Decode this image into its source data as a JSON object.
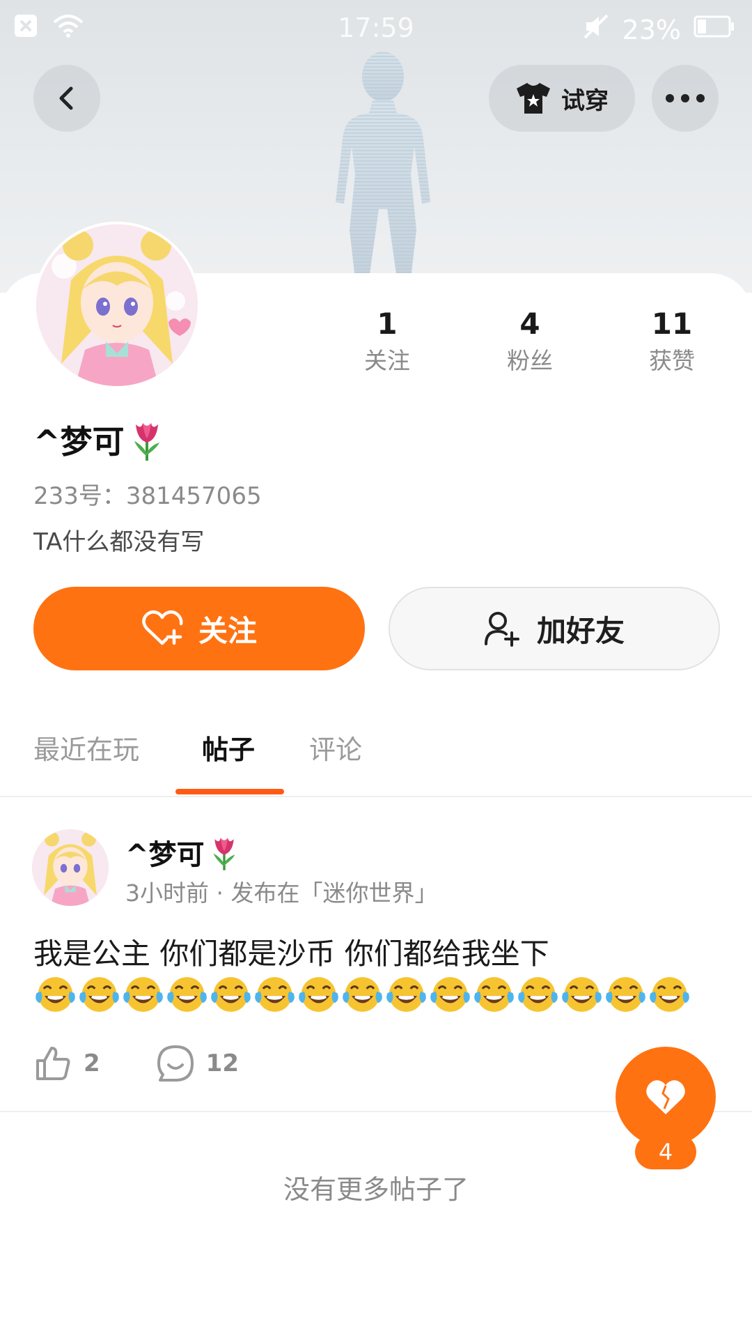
{
  "status_bar": {
    "time": "17:59",
    "battery_pct": "23%",
    "icons": [
      "close-notification-icon",
      "wifi-icon",
      "mute-icon",
      "battery-icon"
    ]
  },
  "header": {
    "try_on_label": "试穿",
    "icons": [
      "back-icon",
      "tshirt-icon",
      "more-icon"
    ]
  },
  "profile": {
    "nickname": "^梦可",
    "uid": "233号：381457065",
    "bio": "TA什么都没有写",
    "stats": [
      {
        "value": "1",
        "label": "关注"
      },
      {
        "value": "4",
        "label": "粉丝"
      },
      {
        "value": "11",
        "label": "获赞"
      }
    ],
    "follow_label": "关注",
    "add_friend_label": "加好友"
  },
  "tabs": [
    {
      "label": "最近在玩",
      "active": false
    },
    {
      "label": "帖子",
      "active": true
    },
    {
      "label": "评论",
      "active": false
    }
  ],
  "post": {
    "author": "^梦可",
    "meta": "3小时前 · 发布在「迷你世界」",
    "text": "我是公主 你们都是沙币 你们都给我坐下",
    "laugh_emoji_count": 15,
    "likes": "2",
    "comments": "12"
  },
  "end_text": "没有更多帖子了",
  "fab": {
    "badge": "4"
  },
  "colors": {
    "accent": "#ff7212",
    "underline": "#ff5a14"
  }
}
